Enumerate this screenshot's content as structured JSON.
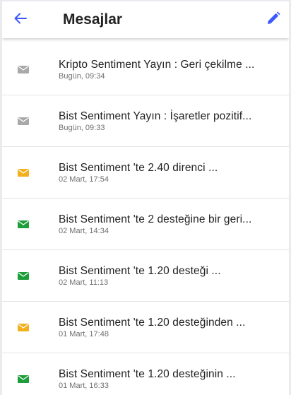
{
  "header": {
    "title": "Mesajlar",
    "accent": "#3d5afe"
  },
  "messages": [
    {
      "subject": "Kripto Sentiment Yayın : Geri çekilme ...",
      "date": "Bugün, 09:34",
      "status": "read",
      "icon": "envelope-icon",
      "color": "#a9a9a9"
    },
    {
      "subject": "Bist Sentiment Yayın : İşaretler pozitif...",
      "date": "Bugün, 09:33",
      "status": "read",
      "icon": "envelope-icon",
      "color": "#a9a9a9"
    },
    {
      "subject": "Bist Sentiment 'te 2.40 direnci ...",
      "date": "02 Mart, 17:54",
      "status": "warning",
      "icon": "envelope-icon",
      "color": "#f2b01e"
    },
    {
      "subject": "Bist Sentiment 'te 2 desteğine bir geri...",
      "date": "02 Mart, 14:34",
      "status": "positive",
      "icon": "envelope-icon",
      "color": "#1e9e3a"
    },
    {
      "subject": "Bist Sentiment 'te 1.20 desteği ...",
      "date": "02 Mart, 11:13",
      "status": "positive",
      "icon": "envelope-icon",
      "color": "#1e9e3a"
    },
    {
      "subject": "Bist Sentiment 'te 1.20 desteğinden ...",
      "date": "01 Mart, 17:48",
      "status": "warning",
      "icon": "envelope-icon",
      "color": "#f2b01e"
    },
    {
      "subject": "Bist Sentiment 'te 1.20 desteğinin ...",
      "date": "01 Mart, 16:33",
      "status": "positive",
      "icon": "envelope-icon",
      "color": "#1e9e3a"
    }
  ]
}
